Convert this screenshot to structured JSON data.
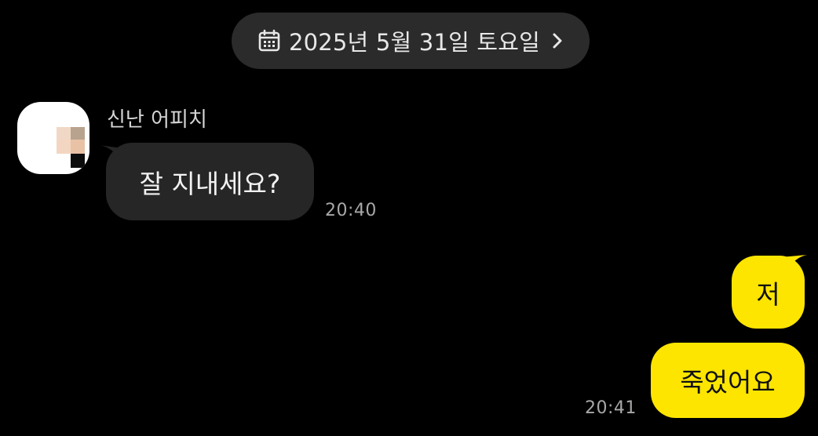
{
  "date_divider": {
    "icon": "calendar-icon",
    "label": "2025년 5월 31일 토요일",
    "chevron": "chevron-right-icon"
  },
  "incoming": {
    "sender_name": "신난 어피치",
    "avatar": "pixelated-profile-image",
    "messages": [
      {
        "text": "잘 지내세요?",
        "time": "20:40"
      }
    ]
  },
  "outgoing": {
    "messages": [
      {
        "text": "저"
      },
      {
        "text": "죽었어요",
        "time": "20:41"
      }
    ]
  },
  "colors": {
    "background": "#000000",
    "incoming_bubble": "#262626",
    "outgoing_bubble": "#fee500",
    "date_pill": "#2b2b2b"
  }
}
